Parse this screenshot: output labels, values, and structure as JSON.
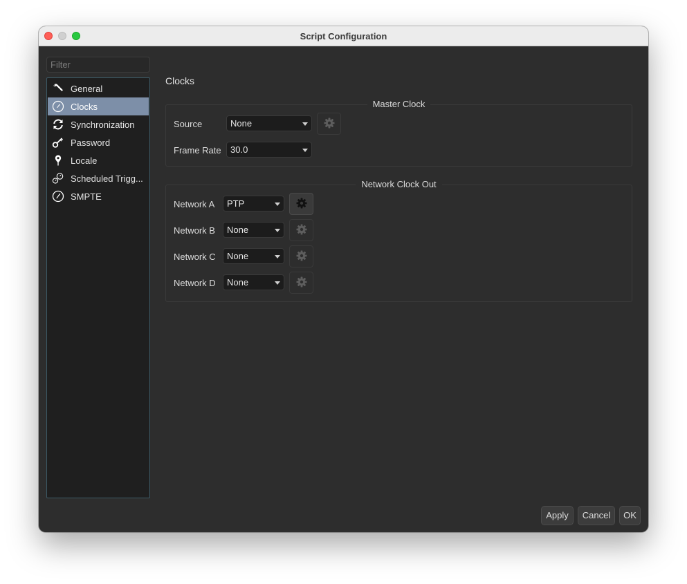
{
  "window": {
    "title": "Script Configuration"
  },
  "filter": {
    "placeholder": "Filter",
    "value": ""
  },
  "sidebar": {
    "items": [
      {
        "label": "General",
        "icon": "wrench-icon",
        "selected": false
      },
      {
        "label": "Clocks",
        "icon": "clock-icon",
        "selected": true
      },
      {
        "label": "Synchronization",
        "icon": "sync-icon",
        "selected": false
      },
      {
        "label": "Password",
        "icon": "key-icon",
        "selected": false
      },
      {
        "label": "Locale",
        "icon": "location-pin-icon",
        "selected": false
      },
      {
        "label": "Scheduled Trigg...",
        "icon": "scheduled-trigger-icon",
        "selected": false
      },
      {
        "label": "SMPTE",
        "icon": "smpte-clock-icon",
        "selected": false
      }
    ]
  },
  "main": {
    "title": "Clocks",
    "master_clock": {
      "group_title": "Master Clock",
      "source_label": "Source",
      "source_value": "None",
      "frame_rate_label": "Frame Rate",
      "frame_rate_value": "30.0"
    },
    "network_clock_out": {
      "group_title": "Network Clock Out",
      "rows": [
        {
          "label": "Network A",
          "value": "PTP",
          "settings_enabled": true
        },
        {
          "label": "Network B",
          "value": "None",
          "settings_enabled": false
        },
        {
          "label": "Network C",
          "value": "None",
          "settings_enabled": false
        },
        {
          "label": "Network D",
          "value": "None",
          "settings_enabled": false
        }
      ]
    }
  },
  "footer": {
    "apply": "Apply",
    "cancel": "Cancel",
    "ok": "OK"
  },
  "colors": {
    "selection": "#7d8fa8",
    "panel": "#2d2d2d",
    "list_bg": "#1f1f1f"
  }
}
